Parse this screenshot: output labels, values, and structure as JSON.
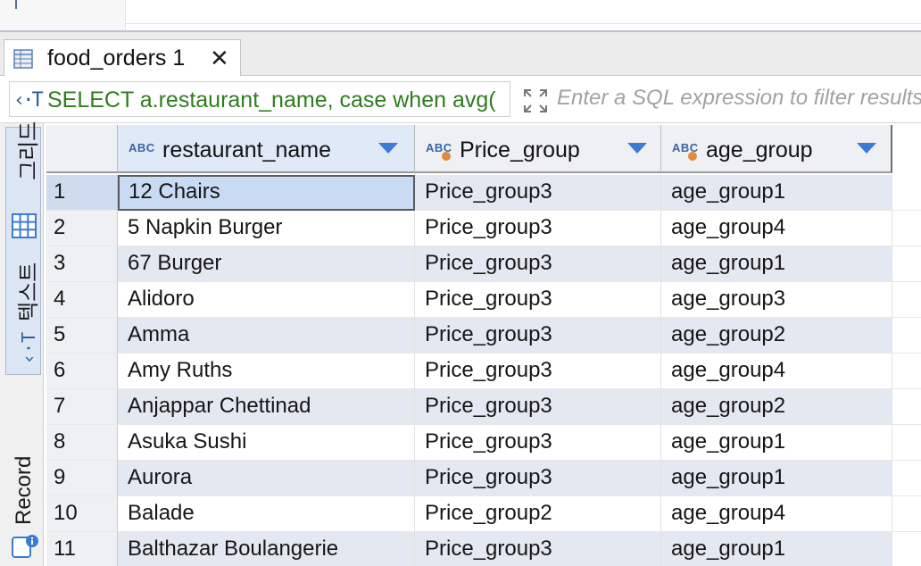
{
  "tab": {
    "title": "food_orders 1",
    "close_glyph": "✕"
  },
  "filter": {
    "sql_icon": "‹·T",
    "sql_text": "SELECT a.restaurant_name, case when avg(",
    "placeholder": "Enter a SQL expression to filter results"
  },
  "side_tabs": {
    "grid_label": "그리드",
    "text_label": "텍스트",
    "record_label": "Record"
  },
  "columns": [
    {
      "type_tag": "ABC",
      "name": "restaurant_name"
    },
    {
      "type_tag": "ABC",
      "name": "Price_group"
    },
    {
      "type_tag": "ABC",
      "name": "age_group"
    }
  ],
  "rows": [
    {
      "n": "1",
      "restaurant_name": "12 Chairs",
      "price_group": "Price_group3",
      "age_group": "age_group1"
    },
    {
      "n": "2",
      "restaurant_name": "5 Napkin Burger",
      "price_group": "Price_group3",
      "age_group": "age_group4"
    },
    {
      "n": "3",
      "restaurant_name": "67 Burger",
      "price_group": "Price_group3",
      "age_group": "age_group1"
    },
    {
      "n": "4",
      "restaurant_name": "Alidoro",
      "price_group": "Price_group3",
      "age_group": "age_group3"
    },
    {
      "n": "5",
      "restaurant_name": "Amma",
      "price_group": "Price_group3",
      "age_group": "age_group2"
    },
    {
      "n": "6",
      "restaurant_name": "Amy Ruths",
      "price_group": "Price_group3",
      "age_group": "age_group4"
    },
    {
      "n": "7",
      "restaurant_name": "Anjappar Chettinad",
      "price_group": "Price_group3",
      "age_group": "age_group2"
    },
    {
      "n": "8",
      "restaurant_name": "Asuka Sushi",
      "price_group": "Price_group3",
      "age_group": "age_group1"
    },
    {
      "n": "9",
      "restaurant_name": "Aurora",
      "price_group": "Price_group3",
      "age_group": "age_group1"
    },
    {
      "n": "10",
      "restaurant_name": "Balade",
      "price_group": "Price_group2",
      "age_group": "age_group4"
    },
    {
      "n": "11",
      "restaurant_name": "Balthazar Boulangerie",
      "price_group": "Price_group3",
      "age_group": "age_group1"
    }
  ],
  "selected_row": 1,
  "colors": {
    "sql_green": "#2f7d1e",
    "accent_blue": "#3a7bd5",
    "row_alt": "#e3e8f1"
  }
}
